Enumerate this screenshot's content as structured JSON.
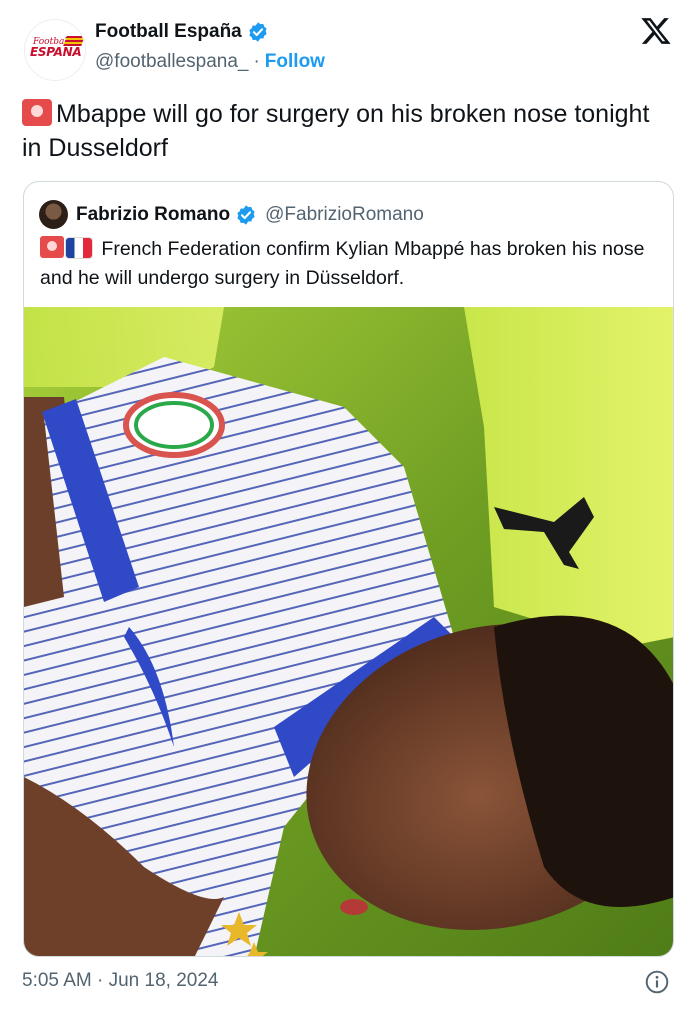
{
  "author": {
    "display_name": "Football España",
    "handle": "@footballespana_",
    "separator": "·",
    "follow_label": "Follow",
    "avatar_logo_small": "Football",
    "avatar_logo_main": "ESPAÑA",
    "verified_icon": "verified-badge-icon"
  },
  "tweet": {
    "text": "Mbappe will go for surgery on his broken nose tonight in Dusseldorf",
    "emoji": "police-siren"
  },
  "quoted": {
    "display_name": "Fabrizio Romano",
    "handle": "@FabrizioRomano",
    "emojis": [
      "police-siren",
      "flag-france"
    ],
    "text": "French Federation confirm Kylian Mbappé has broken his nose and he will undergo surgery in Düsseldorf."
  },
  "footer": {
    "timestamp": "5:05 AM · Jun 18, 2024"
  },
  "colors": {
    "accent": "#1d9bf0",
    "secondary_text": "#536471",
    "border": "#cfd9de",
    "siren_red": "#e54b4b",
    "jersey_blue": "#2f49c7",
    "pitch_green": "#7fb02a"
  }
}
